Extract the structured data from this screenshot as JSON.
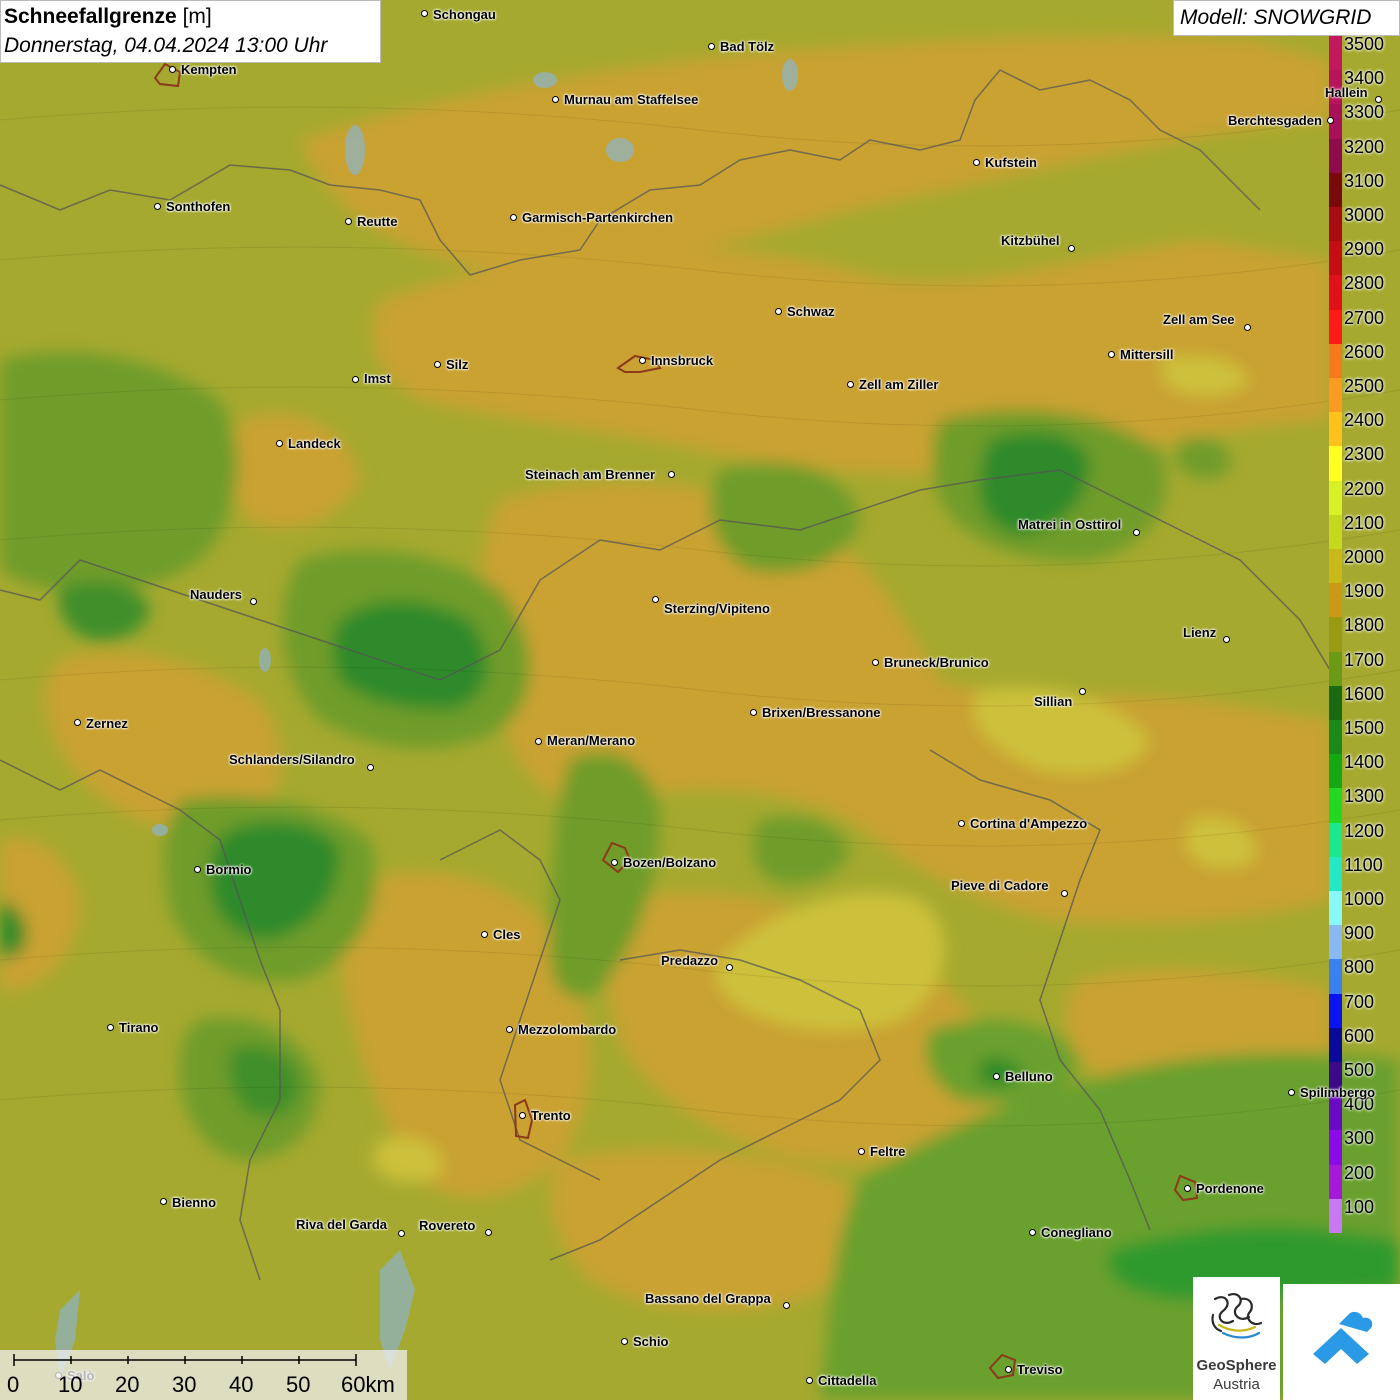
{
  "title": {
    "main": "Schneefallgrenze",
    "unit": "[m]",
    "subtitle": "Donnerstag, 04.04.2024 13:00 Uhr"
  },
  "model_label": "Modell: SNOWGRID",
  "legend": {
    "entries": [
      {
        "label": "3500",
        "color": "#c1185e"
      },
      {
        "label": "3400",
        "color": "#b8145b"
      },
      {
        "label": "3300",
        "color": "#a8105a"
      },
      {
        "label": "3200",
        "color": "#8e0c4e"
      },
      {
        "label": "3100",
        "color": "#7a0a0a"
      },
      {
        "label": "3000",
        "color": "#a80c10"
      },
      {
        "label": "2900",
        "color": "#c40e14"
      },
      {
        "label": "2800",
        "color": "#e0111a"
      },
      {
        "label": "2700",
        "color": "#ff1a1a"
      },
      {
        "label": "2600",
        "color": "#f57a1c"
      },
      {
        "label": "2500",
        "color": "#fb9a20"
      },
      {
        "label": "2400",
        "color": "#ffc21c"
      },
      {
        "label": "2300",
        "color": "#ffff22"
      },
      {
        "label": "2200",
        "color": "#d8f026"
      },
      {
        "label": "2100",
        "color": "#c4d81e"
      },
      {
        "label": "2000",
        "color": "#c8b81a"
      },
      {
        "label": "1900",
        "color": "#c89a18"
      },
      {
        "label": "1800",
        "color": "#9a9a14"
      },
      {
        "label": "1700",
        "color": "#6a9a16"
      },
      {
        "label": "1600",
        "color": "#1a6a14"
      },
      {
        "label": "1500",
        "color": "#1a8a1a"
      },
      {
        "label": "1400",
        "color": "#14a814"
      },
      {
        "label": "1300",
        "color": "#22d822"
      },
      {
        "label": "1200",
        "color": "#1ae88c"
      },
      {
        "label": "1100",
        "color": "#22e8c4"
      },
      {
        "label": "1000",
        "color": "#88f8f8"
      },
      {
        "label": "900",
        "color": "#8ab8f0"
      },
      {
        "label": "800",
        "color": "#3a80f0"
      },
      {
        "label": "700",
        "color": "#0a14f0"
      },
      {
        "label": "600",
        "color": "#0a0a9a"
      },
      {
        "label": "500",
        "color": "#3a0a8a"
      },
      {
        "label": "400",
        "color": "#6a0ac4"
      },
      {
        "label": "300",
        "color": "#8a0ae8"
      },
      {
        "label": "200",
        "color": "#a41ad8"
      },
      {
        "label": "100",
        "color": "#c878f0"
      }
    ]
  },
  "cities": [
    {
      "name": "Schongau"
    },
    {
      "name": "Kempten"
    },
    {
      "name": "Bad Tölz"
    },
    {
      "name": "Murnau am Staffelsee"
    },
    {
      "name": "Sonthofen"
    },
    {
      "name": "Reutte"
    },
    {
      "name": "Garmisch-Partenkirchen"
    },
    {
      "name": "Kufstein"
    },
    {
      "name": "Berchtesgaden"
    },
    {
      "name": "Hallein"
    },
    {
      "name": "Kitzbühel"
    },
    {
      "name": "Schwaz"
    },
    {
      "name": "Zell am See"
    },
    {
      "name": "Mittersill"
    },
    {
      "name": "Innsbruck"
    },
    {
      "name": "Imst"
    },
    {
      "name": "Silz"
    },
    {
      "name": "Zell am Ziller"
    },
    {
      "name": "Landeck"
    },
    {
      "name": "Steinach am Brenner"
    },
    {
      "name": "Matrei in Osttirol"
    },
    {
      "name": "Nauders"
    },
    {
      "name": "Sterzing/Vipiteno"
    },
    {
      "name": "Lienz"
    },
    {
      "name": "Bruneck/Brunico"
    },
    {
      "name": "Sillian"
    },
    {
      "name": "Zernez"
    },
    {
      "name": "Brixen/Bressanone"
    },
    {
      "name": "Meran/Merano"
    },
    {
      "name": "Schlanders/Silandro"
    },
    {
      "name": "Cortina d'Ampezzo"
    },
    {
      "name": "Bormio"
    },
    {
      "name": "Bozen/Bolzano"
    },
    {
      "name": "Pieve di Cadore"
    },
    {
      "name": "Cles"
    },
    {
      "name": "Predazzo"
    },
    {
      "name": "Tirano"
    },
    {
      "name": "Mezzolombardo"
    },
    {
      "name": "Belluno"
    },
    {
      "name": "Spilimbergo"
    },
    {
      "name": "Trento"
    },
    {
      "name": "Feltre"
    },
    {
      "name": "Pordenone"
    },
    {
      "name": "Bienno"
    },
    {
      "name": "Riva del Garda"
    },
    {
      "name": "Rovereto"
    },
    {
      "name": "Conegliano"
    },
    {
      "name": "Bassano del Grappa"
    },
    {
      "name": "Schio"
    },
    {
      "name": "Treviso"
    },
    {
      "name": "Cittadella"
    },
    {
      "name": "Salò"
    }
  ],
  "scale": {
    "labels": [
      "0",
      "10",
      "20",
      "30",
      "40",
      "50",
      "60km"
    ]
  },
  "logos": {
    "geosphere_line1": "GeoSphere",
    "geosphere_line2": "Austria"
  }
}
